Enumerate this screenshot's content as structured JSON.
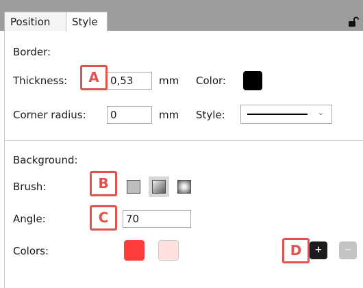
{
  "tabs": [
    {
      "label": "Position"
    },
    {
      "label": "Style"
    }
  ],
  "border": {
    "heading": "Border:",
    "thickness_label": "Thickness:",
    "thickness_value": "0,53",
    "thickness_unit": "mm",
    "color_label": "Color:",
    "color_value": "#000000",
    "corner_radius_label": "Corner radius:",
    "corner_radius_value": "0",
    "corner_radius_unit": "mm",
    "style_label": "Style:",
    "style_selected": "solid-line"
  },
  "background": {
    "heading": "Background:",
    "brush_label": "Brush:",
    "brush_options": [
      "solid",
      "linear-gradient",
      "radial-gradient"
    ],
    "brush_selected": "linear-gradient",
    "angle_label": "Angle:",
    "angle_value": "70",
    "colors_label": "Colors:",
    "colors": [
      "#ff3b3b",
      "#ffe0dc"
    ],
    "add_color_label": "+",
    "remove_color_label": "−"
  },
  "callouts": {
    "a": "A",
    "b": "B",
    "c": "C",
    "d": "D"
  },
  "colors": {
    "accent_callout": "#e2514a",
    "tabbar_background": "#9a9a9a"
  },
  "icons": {
    "lock": "lock-open-icon",
    "dropdown": "chevron-down-icon"
  }
}
